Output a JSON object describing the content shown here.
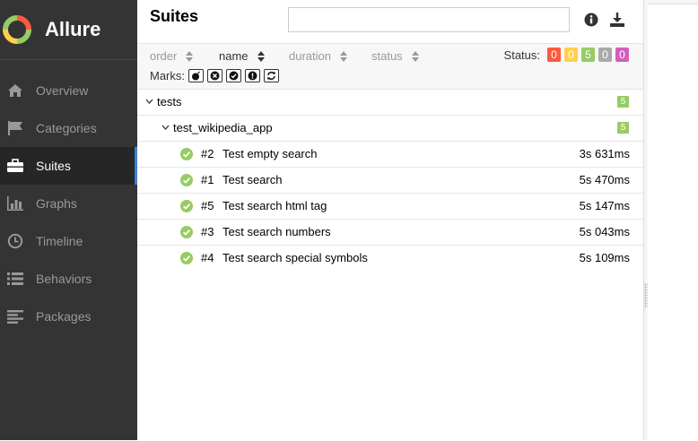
{
  "app": {
    "name": "Allure"
  },
  "sidebar": {
    "items": [
      {
        "label": "Overview",
        "icon": "home-icon",
        "active": false
      },
      {
        "label": "Categories",
        "icon": "flag-icon",
        "active": false
      },
      {
        "label": "Suites",
        "icon": "briefcase-icon",
        "active": true
      },
      {
        "label": "Graphs",
        "icon": "bar-chart-icon",
        "active": false
      },
      {
        "label": "Timeline",
        "icon": "clock-icon",
        "active": false
      },
      {
        "label": "Behaviors",
        "icon": "list-icon",
        "active": false
      },
      {
        "label": "Packages",
        "icon": "align-left-icon",
        "active": false
      }
    ]
  },
  "header": {
    "title": "Suites",
    "search_value": ""
  },
  "sort": {
    "order": "order",
    "name": "name",
    "duration": "duration",
    "status": "status"
  },
  "status_filter": {
    "label": "Status:",
    "badges": [
      {
        "value": "0",
        "color": "#fd5a3e"
      },
      {
        "value": "0",
        "color": "#ffd050"
      },
      {
        "value": "5",
        "color": "#97cc64"
      },
      {
        "value": "0",
        "color": "#aaaaaa"
      },
      {
        "value": "0",
        "color": "#d35ebe"
      }
    ]
  },
  "marks": {
    "label": "Marks:"
  },
  "tree": {
    "root": {
      "label": "tests",
      "count": "5"
    },
    "suite": {
      "label": "test_wikipedia_app",
      "count": "5"
    },
    "tests": [
      {
        "num": "#2",
        "name": "Test empty search",
        "duration": "3s 631ms"
      },
      {
        "num": "#1",
        "name": "Test search",
        "duration": "5s 470ms"
      },
      {
        "num": "#5",
        "name": "Test search html tag",
        "duration": "5s 147ms"
      },
      {
        "num": "#3",
        "name": "Test search numbers",
        "duration": "5s 043ms"
      },
      {
        "num": "#4",
        "name": "Test search special symbols",
        "duration": "5s 109ms"
      }
    ]
  },
  "colors": {
    "passed": "#97cc64",
    "sidebar_bg": "#343434",
    "accent": "#3d7ed3"
  }
}
